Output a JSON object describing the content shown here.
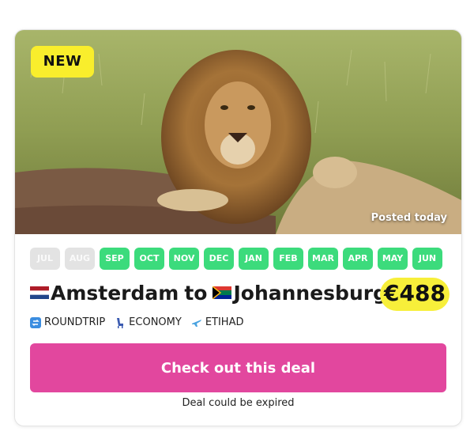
{
  "deal": {
    "badge": "NEW",
    "posted": "Posted today",
    "months": [
      {
        "label": "JUL",
        "active": false
      },
      {
        "label": "AUG",
        "active": false
      },
      {
        "label": "SEP",
        "active": true
      },
      {
        "label": "OCT",
        "active": true
      },
      {
        "label": "NOV",
        "active": true
      },
      {
        "label": "DEC",
        "active": true
      },
      {
        "label": "JAN",
        "active": true
      },
      {
        "label": "FEB",
        "active": true
      },
      {
        "label": "MAR",
        "active": true
      },
      {
        "label": "APR",
        "active": true
      },
      {
        "label": "MAY",
        "active": true
      },
      {
        "label": "JUN",
        "active": true
      }
    ],
    "origin": "Amsterdam",
    "connector": "to",
    "destination": "Johannesburg",
    "origin_flag": "netherlands-flag",
    "destination_flag": "south-africa-flag",
    "price": "€488",
    "trip_type": "ROUNDTRIP",
    "cabin": "ECONOMY",
    "airline": "ETIHAD",
    "cta_label": "Check out this deal",
    "disclaimer": "Deal could be expired",
    "colors": {
      "active_month": "#3cdb7c",
      "inactive_month": "#e3e3e3",
      "cta": "#e2479e",
      "badge": "#f9ee2c",
      "price_highlight": "#f7ef3a"
    }
  }
}
